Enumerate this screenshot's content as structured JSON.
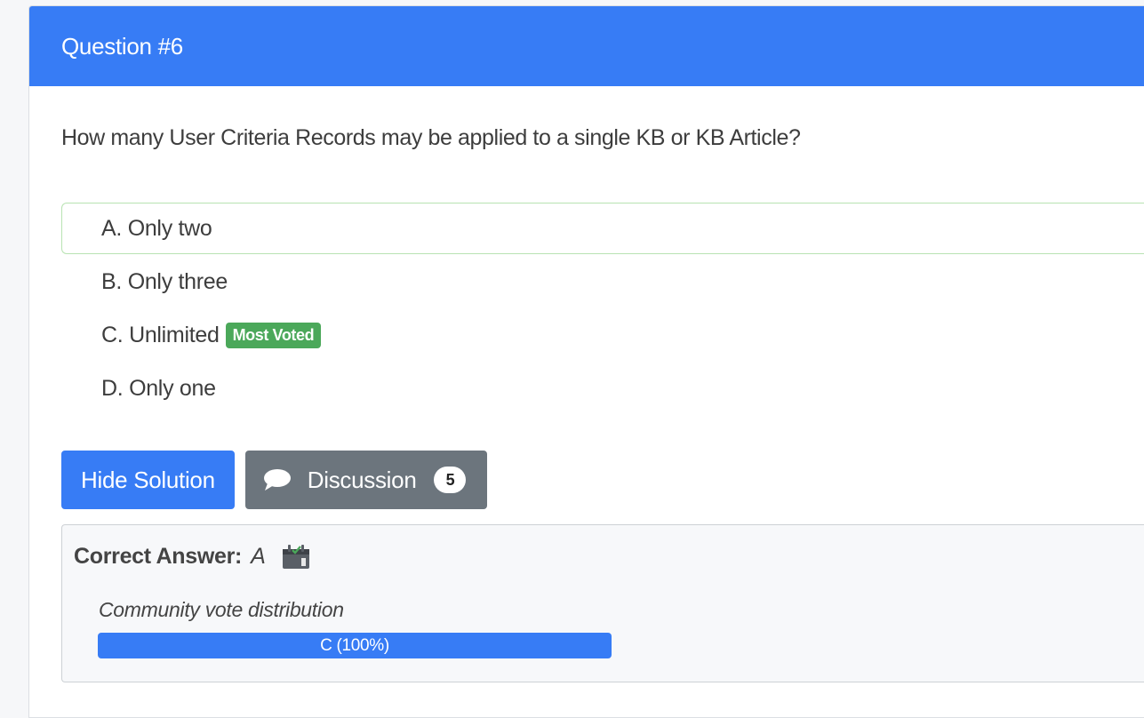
{
  "question": {
    "header": "Question #6",
    "text": "How many User Criteria Records may be applied to a single KB or KB Article?",
    "choices": [
      {
        "letter": "A.",
        "text": "Only two",
        "selected": true
      },
      {
        "letter": "B.",
        "text": "Only three",
        "selected": false
      },
      {
        "letter": "C.",
        "text": "Unlimited",
        "selected": false,
        "badge": "Most Voted"
      },
      {
        "letter": "D.",
        "text": "Only one",
        "selected": false
      }
    ]
  },
  "buttons": {
    "hide_solution": "Hide Solution",
    "discussion": "Discussion",
    "discussion_count": "5"
  },
  "answer": {
    "label": "Correct Answer:",
    "value": "A",
    "vote_title": "Community vote distribution",
    "vote_label": "C (100%)",
    "vote_fraction": 1.0
  },
  "colors": {
    "primary": "#377cf5",
    "secondary": "#6c757d",
    "success": "#4ba85a",
    "selected_border": "#b8e3b2"
  },
  "icons": {
    "discussion": "chat-bubble-icon",
    "correct_answer": "calendar-check-icon"
  }
}
